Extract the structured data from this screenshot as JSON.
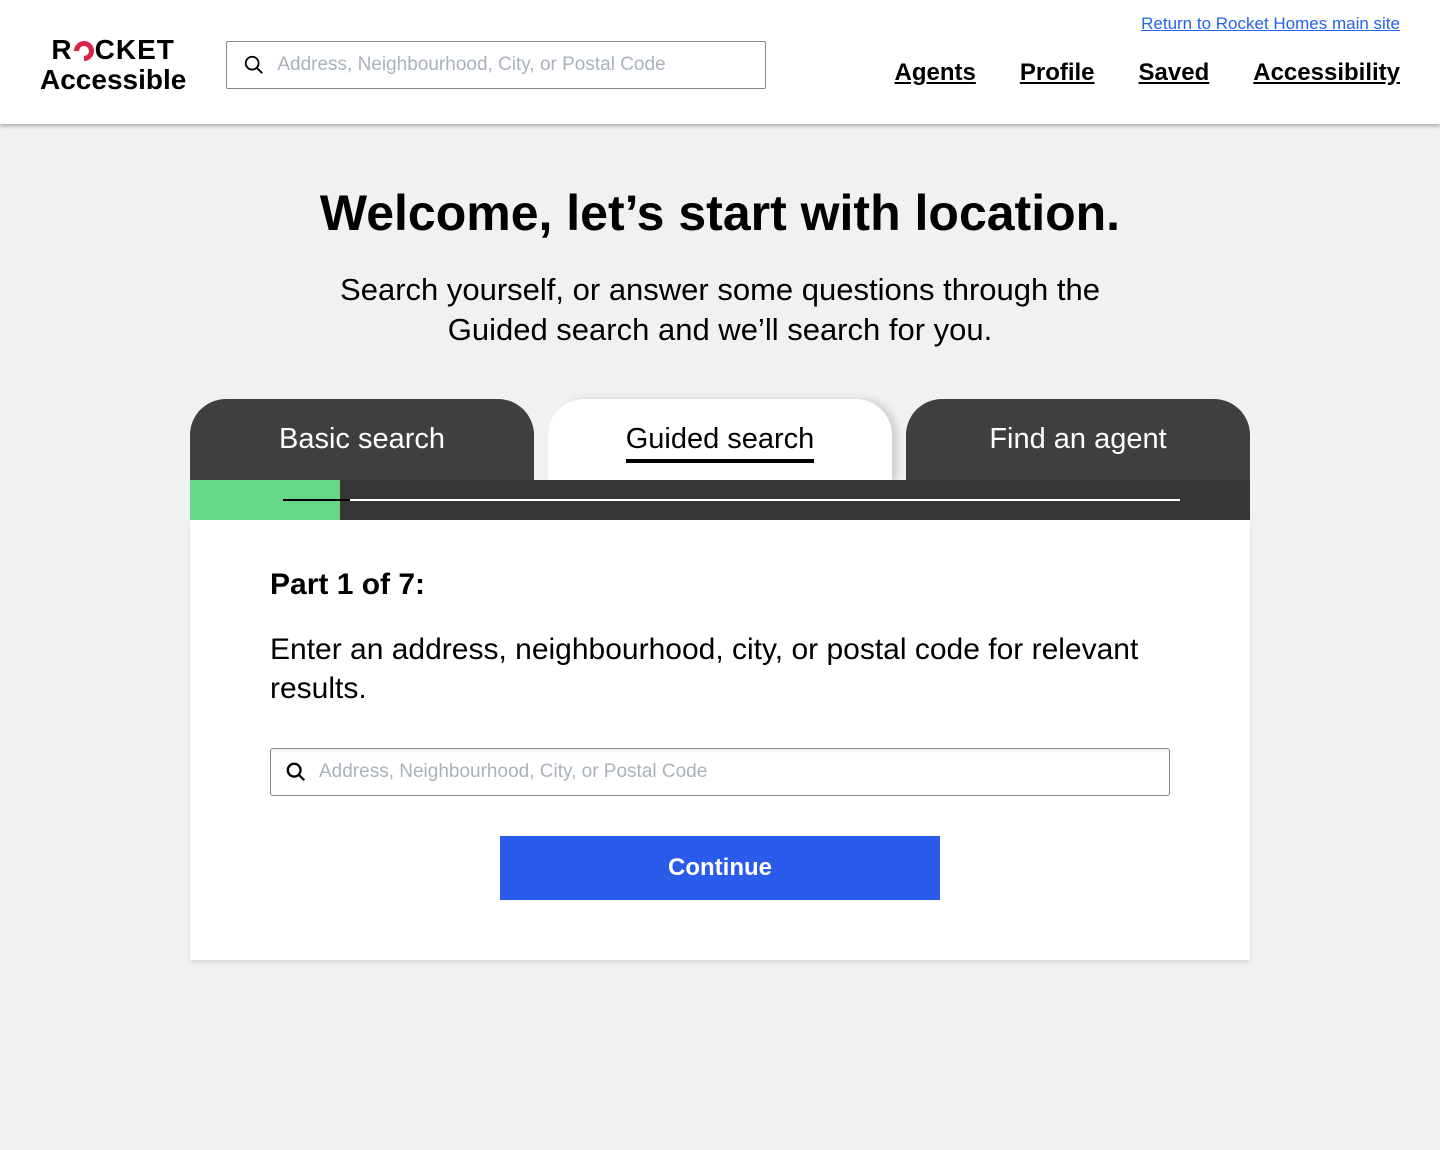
{
  "header": {
    "return_link": "Return to Rocket Homes main site",
    "logo_top": "ROCKET",
    "logo_bottom": "Accessible",
    "search_placeholder": "Address, Neighbourhood, City, or Postal Code",
    "nav": {
      "agents": "Agents",
      "profile": "Profile",
      "saved": "Saved",
      "accessibility": "Accessibility"
    }
  },
  "main": {
    "title": "Welcome, let’s start with location.",
    "subtitle": "Search yourself, or answer some questions through the Guided search and we’ll search for you.",
    "tabs": {
      "basic": "Basic search",
      "guided": "Guided search",
      "agent": "Find an agent"
    },
    "progress": {
      "current": 1,
      "total": 7
    },
    "panel": {
      "part_label": "Part 1 of 7:",
      "instruction": "Enter an address, neighbourhood, city, or postal code for relevant results.",
      "search_placeholder": "Address, Neighbourhood, City, or Postal Code",
      "continue": "Continue"
    }
  }
}
